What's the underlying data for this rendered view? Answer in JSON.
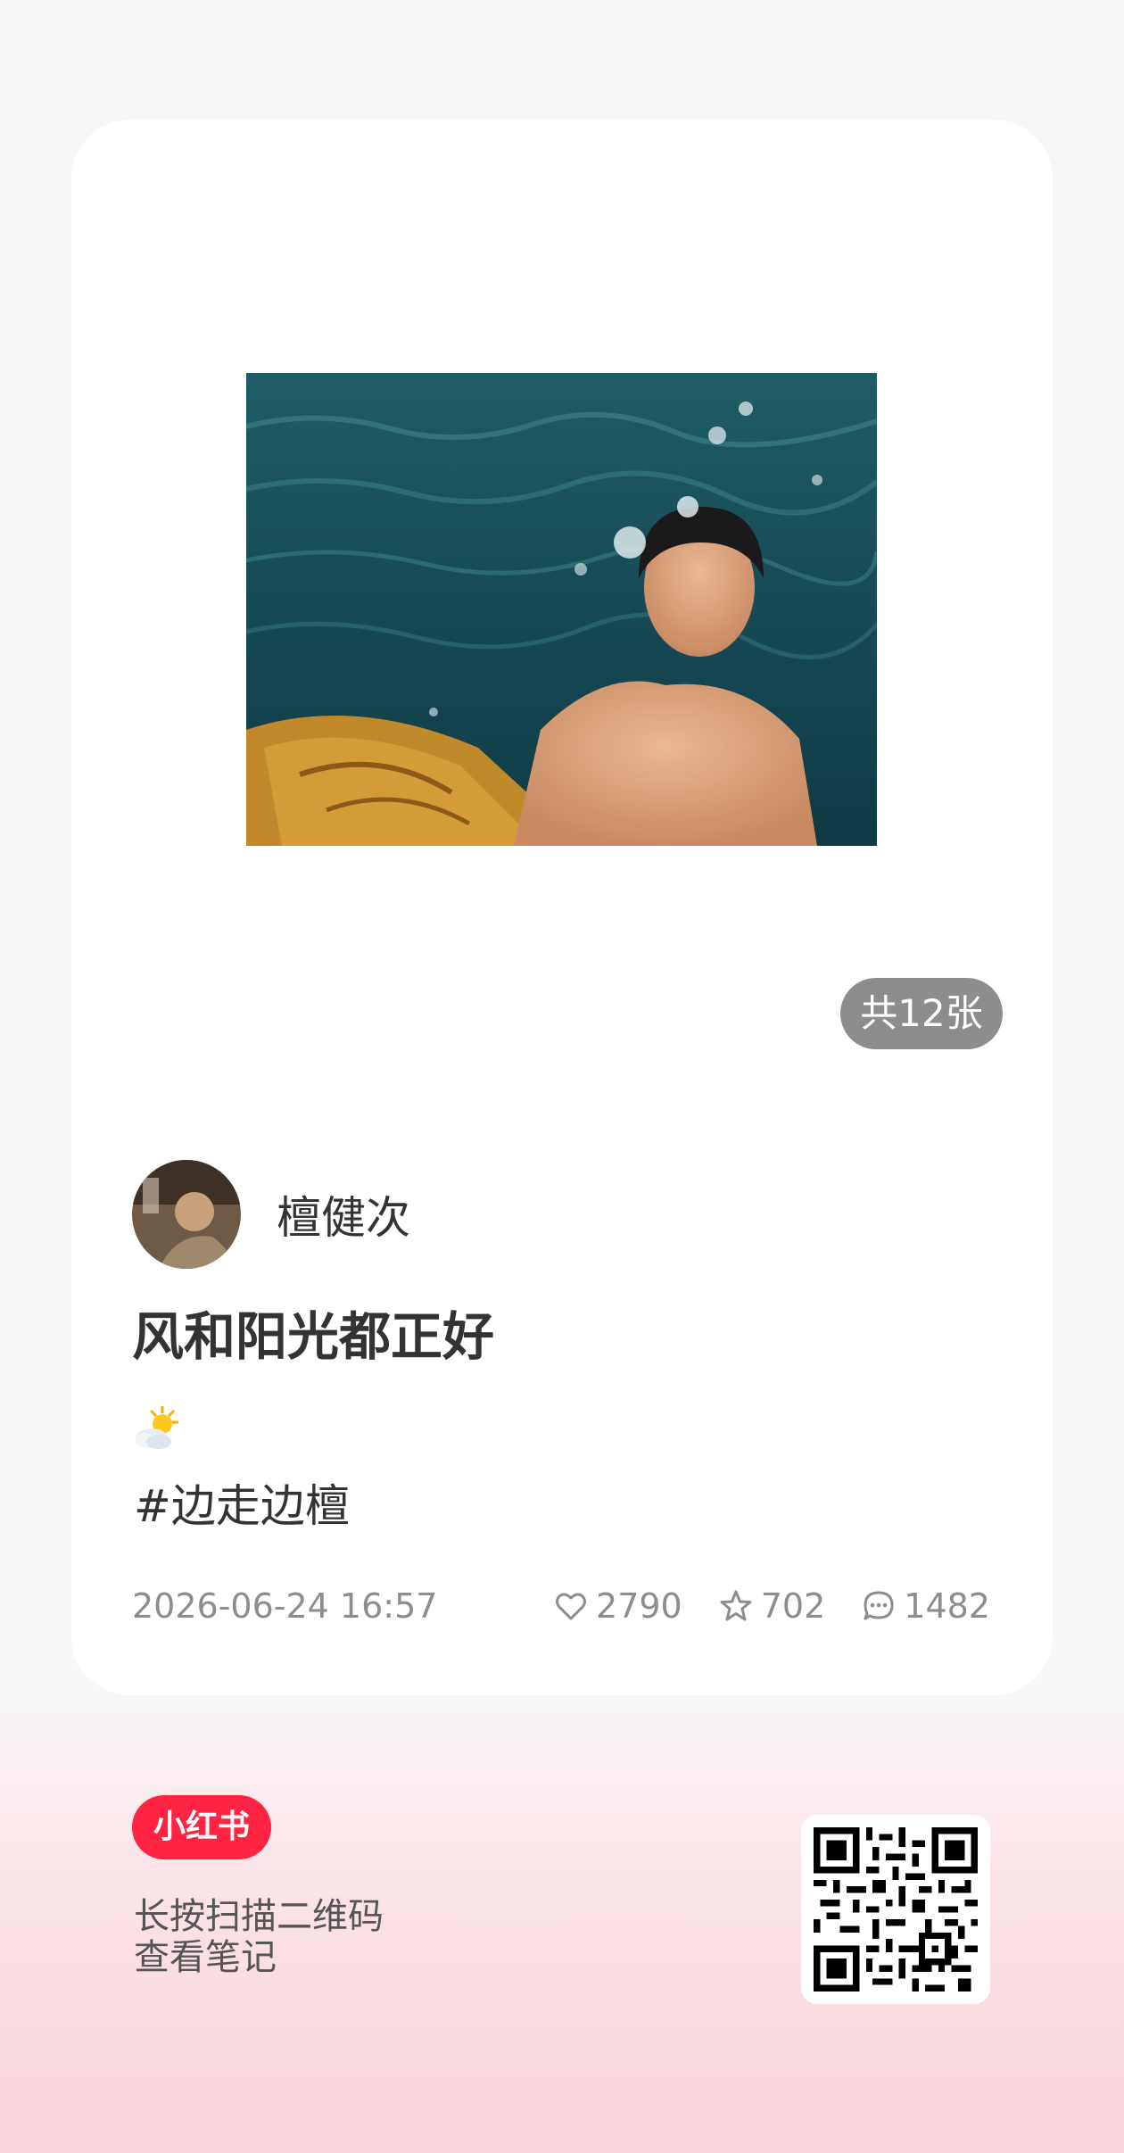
{
  "photo": {
    "count_label": "共12张"
  },
  "author": {
    "name": "檀健次"
  },
  "post": {
    "title": "风和阳光都正好",
    "hashtag": "#边走边檀",
    "date": "2026-06-24 16:57",
    "likes": "2790",
    "collects": "702",
    "comments": "1482"
  },
  "footer": {
    "logo": "小红书",
    "line1": "长按扫描二维码",
    "line2": "查看笔记"
  },
  "colors": {
    "brand": "#ff2442",
    "badge": "#8d8d8d",
    "text": "#333333",
    "meta": "#8d8d8d"
  },
  "icons": [
    "sun-behind-cloud-icon",
    "heart-icon",
    "star-icon",
    "comment-icon",
    "qr-code"
  ]
}
